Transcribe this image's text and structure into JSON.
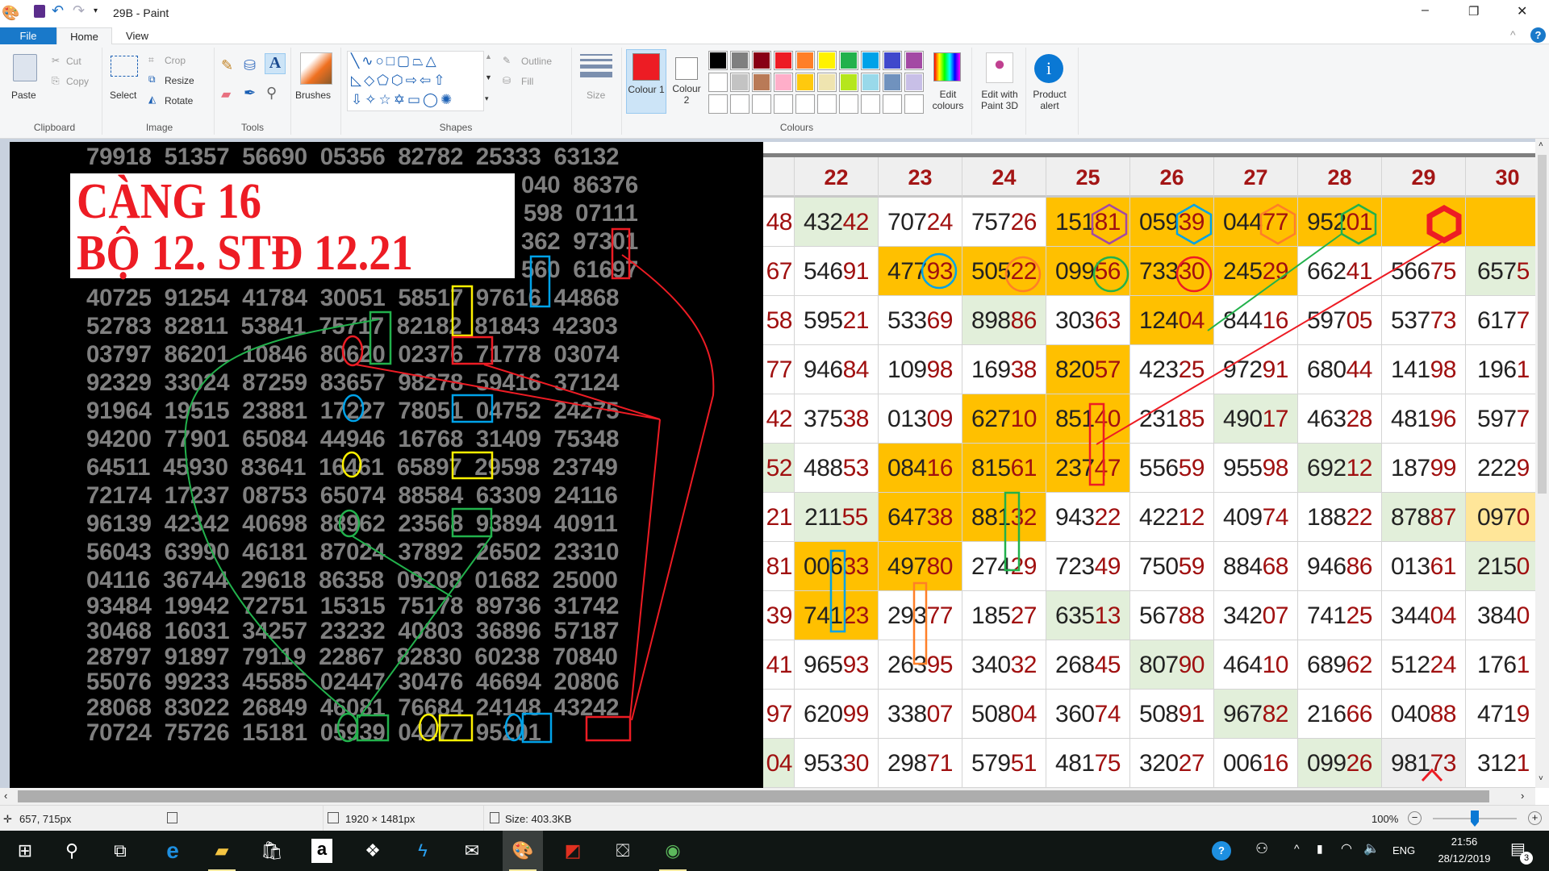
{
  "titlebar": {
    "title": "29B - Paint",
    "minimize": "–",
    "restore": "❐",
    "close": "✕"
  },
  "tabs": {
    "file": "File",
    "home": "Home",
    "view": "View"
  },
  "ribbon": {
    "clipboard": {
      "label": "Clipboard",
      "paste": "Paste",
      "cut": "Cut",
      "copy": "Copy"
    },
    "image": {
      "label": "Image",
      "select": "Select",
      "crop": "Crop",
      "resize": "Resize",
      "rotate": "Rotate"
    },
    "tools": {
      "label": "Tools"
    },
    "brushes": {
      "label": "Brushes"
    },
    "shapes": {
      "label": "Shapes",
      "outline": "Outline",
      "fill": "Fill"
    },
    "size": {
      "label": "Size"
    },
    "colours": {
      "label": "Colours",
      "colour1": "Colour 1",
      "colour1_value": "#ed1c24",
      "colour2": "Colour 2",
      "colour2_value": "#ffffff",
      "palette_row1": [
        "#000000",
        "#7f7f7f",
        "#880015",
        "#ed1c24",
        "#ff7f27",
        "#fff200",
        "#22b14c",
        "#00a2e8",
        "#3f48cc",
        "#a349a4"
      ],
      "palette_row2": [
        "#ffffff",
        "#c3c3c3",
        "#b97a57",
        "#ffaec9",
        "#ffc90e",
        "#efe4b0",
        "#b5e61d",
        "#99d9ea",
        "#7092be",
        "#c8bfe7"
      ],
      "palette_row3": [
        "#ffffff",
        "#ffffff",
        "#ffffff",
        "#ffffff",
        "#ffffff",
        "#ffffff",
        "#ffffff",
        "#ffffff",
        "#ffffff",
        "#ffffff"
      ],
      "edit_colours": "Edit colours"
    },
    "paint3d": "Edit with Paint 3D",
    "product_alert": "Product alert"
  },
  "canvas": {
    "title_line1": "CÀNG 16",
    "title_line2": "BỘ 12. STĐ 12.21",
    "rows": [
      "79918 51357 56690 05356 82782 25333 63132",
      "040 86376",
      "598 07111",
      "362 97301",
      "560 61697",
      "40725 91254 41784 30051 58517 97616 44868",
      "52783 82811 53841 75717 82182 81843 42303",
      "03797 86201 10846 80620 02376 71778 03074",
      "92329 33024 87259 83657 98278 59416 37124",
      "91964 19515 23881 17227 78051 04752 24275",
      "94200 77901 65084 44946 16768 31409 75348",
      "64511 45930 83641 16461 65897 29598 23749",
      "72174 17237 08753 65074 88584 63309 24116",
      "96139 42342 40698 88962 23568 93894 40911",
      "56043 63990 46181 87024 37892 26502 23310",
      "04116 36744 29618 86358 09208 01682 25000",
      "93484 19942 72751 15315 75178 89736 31742",
      "30468 16031 34257 23232 40803 36896 57187",
      "28797 91897 79119 22867 82830 60238 70840",
      "55076 99233 45585 02447 30476 46694 20806",
      "28068 83022 26849 46081 76684 24148 43242",
      "70724 75726 15181 05939 04477 95201"
    ],
    "table": {
      "headers": [
        "",
        "22",
        "23",
        "24",
        "25",
        "26",
        "27",
        "28",
        "29",
        "30"
      ],
      "rows": [
        [
          "48",
          "43242",
          "70724",
          "75726",
          "15181",
          "05939",
          "04477",
          "95201",
          "",
          ""
        ],
        [
          "67",
          "54691",
          "47793",
          "50522",
          "09956",
          "73330",
          "24529",
          "66241",
          "56675",
          "6575"
        ],
        [
          "58",
          "59521",
          "53369",
          "89886",
          "30363",
          "12404",
          "84416",
          "59705",
          "53773",
          "6177"
        ],
        [
          "77",
          "94684",
          "10998",
          "16938",
          "82057",
          "42325",
          "97291",
          "68044",
          "14198",
          "1961"
        ],
        [
          "42",
          "37538",
          "01309",
          "62710",
          "85140",
          "23185",
          "49017",
          "46328",
          "48196",
          "5977"
        ],
        [
          "52",
          "48853",
          "08416",
          "81561",
          "23747",
          "55659",
          "95598",
          "69212",
          "18799",
          "2229"
        ],
        [
          "21",
          "21155",
          "64738",
          "88132",
          "94322",
          "42212",
          "40974",
          "18822",
          "87887",
          "0970"
        ],
        [
          "81",
          "00633",
          "49780",
          "27429",
          "72349",
          "75059",
          "88468",
          "94686",
          "01361",
          "2150"
        ],
        [
          "39",
          "74123",
          "29377",
          "18527",
          "63513",
          "56788",
          "34207",
          "74125",
          "34404",
          "3840"
        ],
        [
          "41",
          "96593",
          "26395",
          "34032",
          "26845",
          "80790",
          "46410",
          "68962",
          "51224",
          "1761"
        ],
        [
          "97",
          "62099",
          "33807",
          "50804",
          "36074",
          "50891",
          "96782",
          "21666",
          "04088",
          "4719"
        ],
        [
          "04",
          "95330",
          "29871",
          "57951",
          "48175",
          "32027",
          "00616",
          "09926",
          "98173",
          "3121"
        ]
      ],
      "fills": [
        "wgwwoooooo",
        "wwooooowwg",
        "wwwgwowwww",
        "wwwwowwwww",
        "wwwoowgwww",
        "gwooowwgww",
        "wgoowwwwgy",
        "woowwwwwwg",
        "wowwgwwwww",
        "wwwwwgwwww",
        "wwwwwwgwww",
        "gwwwwwwgsw"
      ],
      "fill_colors": {
        "o": "#ffc000",
        "g": "#e2efda",
        "y": "#ffe699",
        "w": "#ffffff",
        "s": "#eeeeee"
      },
      "header_color": "#a31515",
      "digit_highlight_color": "#a01010"
    }
  },
  "statusbar": {
    "cursor": "657, 715px",
    "dimensions": "1920 × 1481px",
    "size": "Size: 403.3KB",
    "zoom": "100%",
    "zoom_level_percent": 100
  },
  "taskbar": {
    "apps": [
      "start",
      "search",
      "task-view",
      "edge",
      "file-explorer",
      "store",
      "amazon",
      "dropbox",
      "visual-studio",
      "mail",
      "paint",
      "app-red",
      "app-plugin",
      "app-green"
    ],
    "lang": "ENG",
    "time": "21:56",
    "date": "28/12/2019",
    "notifications": "3"
  }
}
